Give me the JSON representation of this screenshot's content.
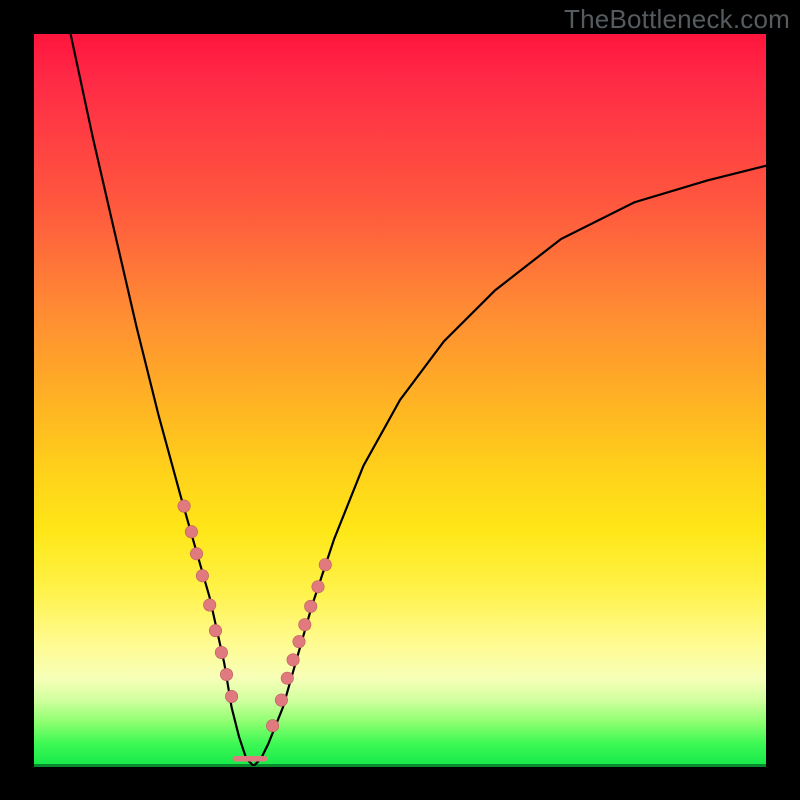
{
  "watermark": "TheBottleneck.com",
  "colors": {
    "frame_bg": "#000000",
    "curve": "#000000",
    "bead_fill": "#e17a7e",
    "bead_stroke": "#bb5a5e",
    "gradient_top": "#ff153d",
    "gradient_bottom": "#15ea4a"
  },
  "chart_data": {
    "type": "line",
    "title": "",
    "xlabel": "",
    "ylabel": "",
    "xlim": [
      0,
      100
    ],
    "ylim": [
      0,
      100
    ],
    "note": "V-shaped bottleneck curve. Lower y = better match (green zone). Minimum around x≈27–32 at y≈0. Pink beads mark sampled points on the curve near the valley; a short flat pink segment marks the optimum region.",
    "series": [
      {
        "name": "bottleneck-curve",
        "x": [
          5,
          8,
          11,
          14,
          17,
          20,
          22,
          24,
          26,
          27,
          28,
          29,
          30,
          31,
          32,
          34,
          36,
          38,
          41,
          45,
          50,
          56,
          63,
          72,
          82,
          92,
          100
        ],
        "y": [
          100,
          86,
          73,
          60,
          48,
          37,
          30,
          23,
          14,
          8,
          4,
          1,
          0,
          1,
          3,
          8,
          15,
          22,
          31,
          41,
          50,
          58,
          65,
          72,
          77,
          80,
          82
        ]
      }
    ],
    "beads_x": [
      20.5,
      21.5,
      22.2,
      23.0,
      24.0,
      24.8,
      25.6,
      26.3,
      27.0,
      32.6,
      33.8,
      34.6,
      35.4,
      36.2,
      37.0,
      37.8,
      38.8,
      39.8
    ],
    "beads_y": [
      35.5,
      32.0,
      29.0,
      26.0,
      22.0,
      18.5,
      15.5,
      12.5,
      9.5,
      5.5,
      9.0,
      12.0,
      14.5,
      17.0,
      19.3,
      21.8,
      24.5,
      27.5
    ],
    "flat_segment": {
      "x0": 27.5,
      "x1": 31.5,
      "y": 1.0
    }
  }
}
